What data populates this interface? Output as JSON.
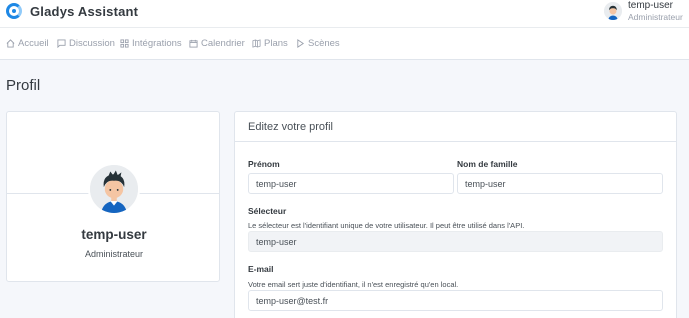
{
  "brand": {
    "name": "Gladys Assistant",
    "logo_icon": "gladys-logo-icon",
    "accent": "#1e88e5"
  },
  "user_menu": {
    "name": "temp-user",
    "role": "Administrateur",
    "avatar_icon": "user-avatar"
  },
  "nav": {
    "items": [
      {
        "label": "Accueil",
        "icon": "home-icon"
      },
      {
        "label": "Discussion",
        "icon": "message-square-icon"
      },
      {
        "label": "Intégrations",
        "icon": "grid-icon"
      },
      {
        "label": "Calendrier",
        "icon": "calendar-icon"
      },
      {
        "label": "Plans",
        "icon": "map-icon"
      },
      {
        "label": "Scènes",
        "icon": "play-icon"
      }
    ]
  },
  "page": {
    "title": "Profil"
  },
  "profile_card": {
    "name": "temp-user",
    "role": "Administrateur"
  },
  "edit_form": {
    "title": "Editez votre profil",
    "firstname": {
      "label": "Prénom",
      "value": "temp-user"
    },
    "lastname": {
      "label": "Nom de famille",
      "value": "temp-user"
    },
    "selector": {
      "label": "Sélecteur",
      "hint": "Le sélecteur est l'identifiant unique de votre utilisateur. Il peut être utilisé dans l'API.",
      "value": "temp-user"
    },
    "email": {
      "label": "E-mail",
      "hint": "Votre email sert juste d'identifiant, il n'est enregistré qu'en local.",
      "value": "temp-user@test.fr"
    }
  }
}
